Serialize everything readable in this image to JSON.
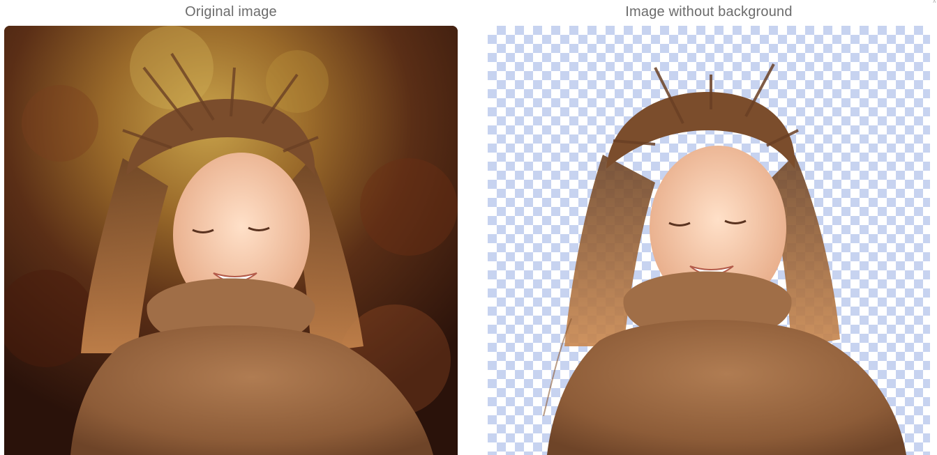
{
  "captions": {
    "original": "Original image",
    "cutout": "Image without background"
  },
  "images": {
    "original": {
      "subject": "photo-girl-windblown-hair-brown-poncho",
      "background": "autumn-forest-bokeh"
    },
    "cutout": {
      "subject": "photo-girl-windblown-hair-brown-poncho",
      "background": "transparent-checkerboard"
    }
  },
  "colors": {
    "caption_text": "#6b6b6b",
    "checker_light": "#ffffff",
    "checker_blue": "#c7d3f0",
    "poncho": "#9b6a45",
    "hair": "#8a5a34",
    "skin": "#f0c2a0"
  }
}
